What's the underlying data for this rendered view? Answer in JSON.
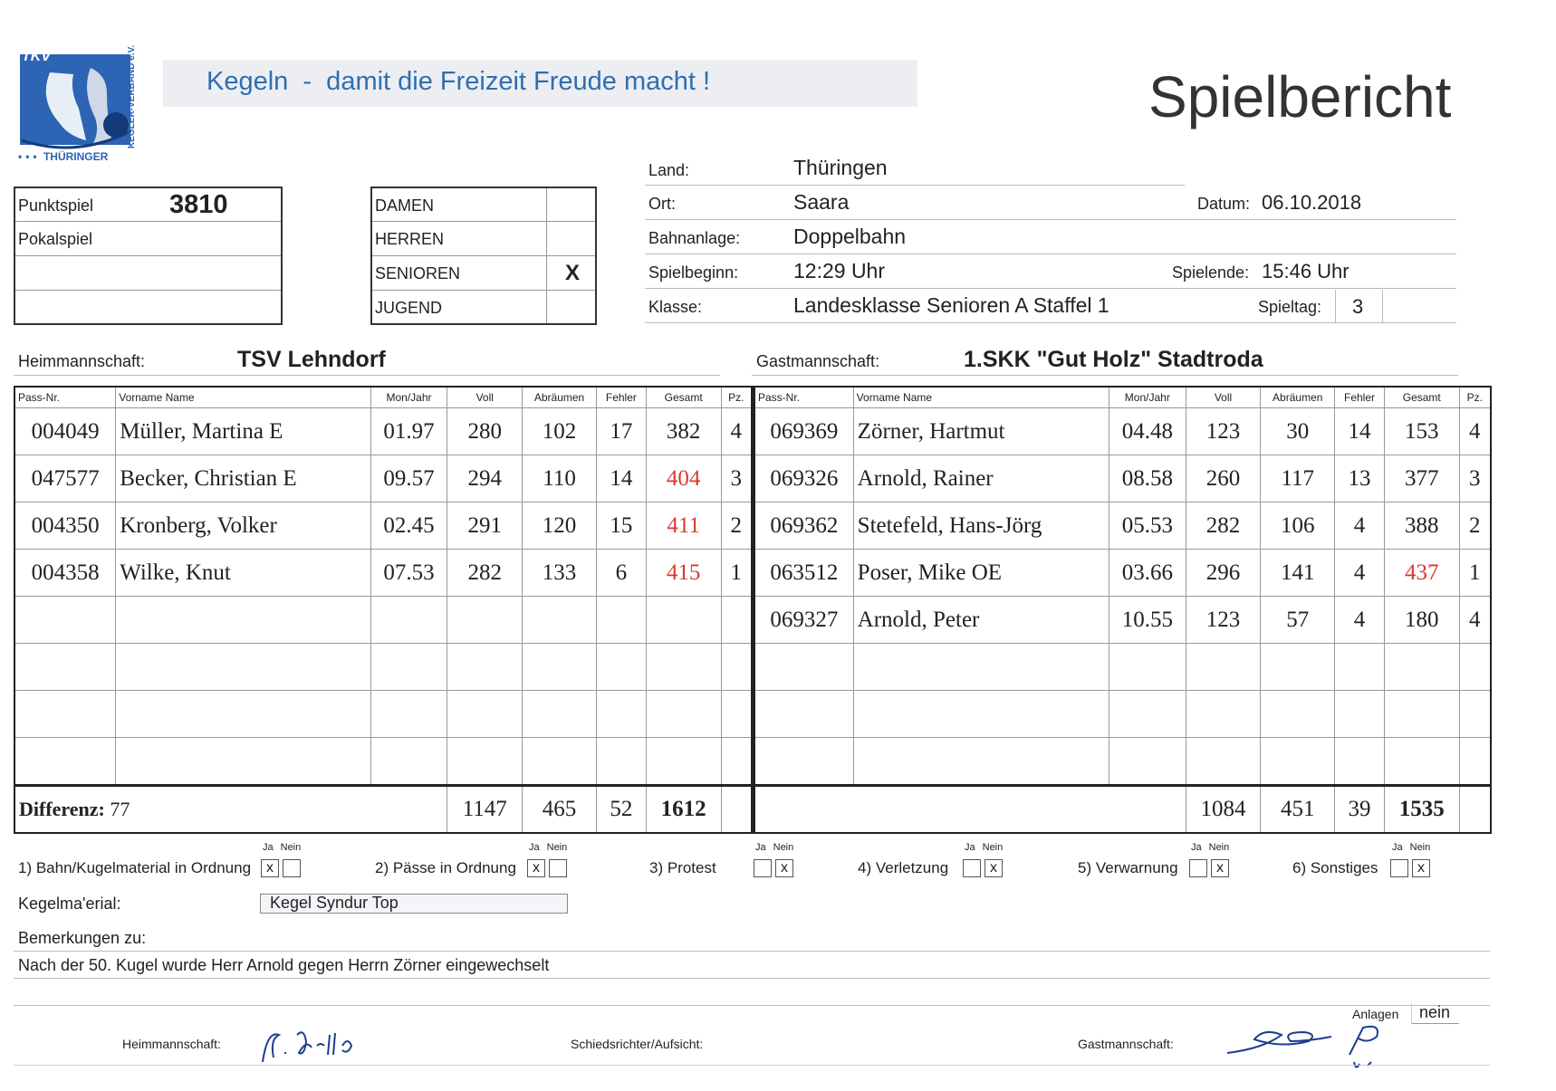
{
  "header": {
    "logo_text": "TKV",
    "logo_sub": "THÜRINGER",
    "logo_side": "KEGLER-VERBAND e.V.",
    "slogan": "Kegeln  -  damit die Freizeit Freude macht !",
    "title": "Spielbericht"
  },
  "game_type": {
    "punktspiel_label": "Punktspiel",
    "punktspiel_number": "3810",
    "pokalspiel_label": "Pokalspiel"
  },
  "category": {
    "damen": "DAMEN",
    "herren": "HERREN",
    "senioren": "SENIOREN",
    "senioren_mark": "X",
    "jugend": "JUGEND"
  },
  "info": {
    "land_label": "Land:",
    "land": "Thüringen",
    "ort_label": "Ort:",
    "ort": "Saara",
    "datum_label": "Datum:",
    "datum": "06.10.2018",
    "bahnanlage_label": "Bahnanlage:",
    "bahnanlage": "Doppelbahn",
    "spielbeginn_label": "Spielbeginn:",
    "spielbeginn": "12:29 Uhr",
    "spielende_label": "Spielende:",
    "spielende": "15:46 Uhr",
    "klasse_label": "Klasse:",
    "klasse": "Landesklasse Senioren A Staffel 1",
    "spieltag_label": "Spieltag:",
    "spieltag": "3"
  },
  "teams": {
    "heim_label": "Heimmannschaft:",
    "heim": "TSV Lehndorf",
    "gast_label": "Gastmannschaft:",
    "gast": "1.SKK \"Gut Holz\" Stadtroda"
  },
  "columns": {
    "pass": "Pass-Nr.",
    "name": "Vorname  Name",
    "monjahr": "Mon/Jahr",
    "voll": "Voll",
    "abr": "Abräumen",
    "fehler": "Fehler",
    "gesamt": "Gesamt",
    "pz": "Pz."
  },
  "home_players": [
    {
      "pass": "004049",
      "name": "Müller, Martina  E",
      "mj": "01.97",
      "voll": "280",
      "abr": "102",
      "fehler": "17",
      "gesamt": "382",
      "pz": "4",
      "red": false
    },
    {
      "pass": "047577",
      "name": "Becker, Christian  E",
      "mj": "09.57",
      "voll": "294",
      "abr": "110",
      "fehler": "14",
      "gesamt": "404",
      "pz": "3",
      "red": true
    },
    {
      "pass": "004350",
      "name": "Kronberg, Volker",
      "mj": "02.45",
      "voll": "291",
      "abr": "120",
      "fehler": "15",
      "gesamt": "411",
      "pz": "2",
      "red": true
    },
    {
      "pass": "004358",
      "name": "Wilke, Knut",
      "mj": "07.53",
      "voll": "282",
      "abr": "133",
      "fehler": "6",
      "gesamt": "415",
      "pz": "1",
      "red": true
    }
  ],
  "guest_players": [
    {
      "pass": "069369",
      "name": "Zörner, Hartmut",
      "mj": "04.48",
      "voll": "123",
      "abr": "30",
      "fehler": "14",
      "gesamt": "153",
      "pz": "4",
      "red": false
    },
    {
      "pass": "069326",
      "name": "Arnold, Rainer",
      "mj": "08.58",
      "voll": "260",
      "abr": "117",
      "fehler": "13",
      "gesamt": "377",
      "pz": "3",
      "red": false
    },
    {
      "pass": "069362",
      "name": "Stetefeld, Hans-Jörg",
      "mj": "05.53",
      "voll": "282",
      "abr": "106",
      "fehler": "4",
      "gesamt": "388",
      "pz": "2",
      "red": false
    },
    {
      "pass": "063512",
      "name": "Poser, Mike OE",
      "mj": "03.66",
      "voll": "296",
      "abr": "141",
      "fehler": "4",
      "gesamt": "437",
      "pz": "1",
      "red": true
    },
    {
      "pass": "069327",
      "name": "Arnold, Peter",
      "mj": "10.55",
      "voll": "123",
      "abr": "57",
      "fehler": "4",
      "gesamt": "180",
      "pz": "4",
      "red": false
    }
  ],
  "totals": {
    "differenz_label": "Differenz:",
    "differenz": "77",
    "home": {
      "voll": "1147",
      "abr": "465",
      "fehler": "52",
      "gesamt": "1612"
    },
    "guest": {
      "voll": "1084",
      "abr": "451",
      "fehler": "39",
      "gesamt": "1535"
    }
  },
  "checks": {
    "ja": "Ja",
    "nein": "Nein",
    "items": [
      {
        "label": "1) Bahn/Kugelmaterial in Ordnung",
        "ja": "x",
        "nein": ""
      },
      {
        "label": "2) Pässe in Ordnung",
        "ja": "x",
        "nein": ""
      },
      {
        "label": "3) Protest",
        "ja": "",
        "nein": "x"
      },
      {
        "label": "4) Verletzung",
        "ja": "",
        "nein": "x"
      },
      {
        "label": "5) Verwarnung",
        "ja": "",
        "nein": "x"
      },
      {
        "label": "6) Sonstiges",
        "ja": "",
        "nein": "x"
      }
    ]
  },
  "material": {
    "label": "Kegelma'erial:",
    "value": "Kegel Syndur Top"
  },
  "remarks": {
    "label": "Bemerkungen zu:",
    "text": "Nach der 50. Kugel wurde Herr Arnold gegen Herrn Zörner eingewechselt"
  },
  "footer": {
    "anlagen_label": "Anlagen",
    "anlagen": "nein",
    "heim_label": "Heimmannschaft:",
    "schiri_label": "Schiedsrichter/Aufsicht:",
    "gast_label": "Gastmannschaft:"
  },
  "colors": {
    "slogan": "#2e6fb0",
    "slogan_bg": "#eceef2",
    "logo_blue": "#2d64b4",
    "red": "#d93a2e",
    "signature": "#1c3d8f"
  }
}
